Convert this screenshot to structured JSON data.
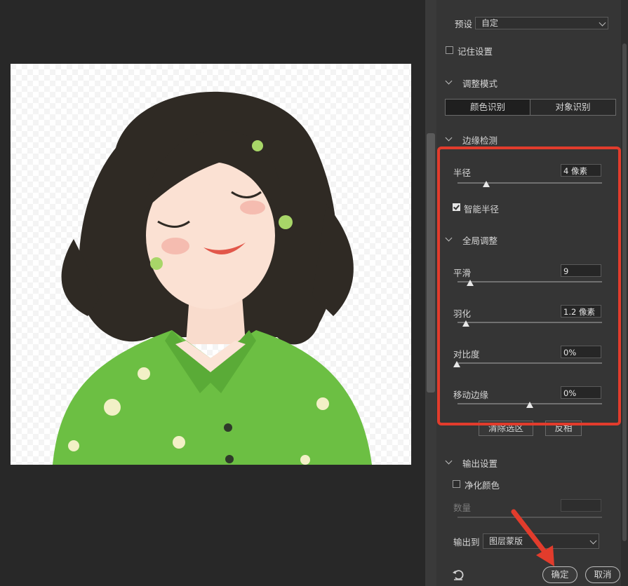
{
  "preset": {
    "label": "预设",
    "value": "自定"
  },
  "remember_settings": {
    "label": "记住设置",
    "checked": false
  },
  "adjust_mode": {
    "title": "调整模式",
    "options": [
      "颜色识别",
      "对象识别"
    ],
    "selected": "颜色识别"
  },
  "edge_detection": {
    "title": "边缘检测",
    "radius": {
      "label": "半径",
      "value": "4 像素",
      "level": 0.2
    },
    "smart_radius": {
      "label": "智能半径",
      "checked": true
    }
  },
  "global_refine": {
    "title": "全局调整",
    "smooth": {
      "label": "平滑",
      "value": "9",
      "level": 0.09
    },
    "feather": {
      "label": "羽化",
      "value": "1.2 像素",
      "level": 0.06
    },
    "contrast": {
      "label": "对比度",
      "value": "0%",
      "level": 0
    },
    "shift_edge": {
      "label": "移动边缘",
      "value": "0%",
      "level": 0.5
    }
  },
  "actions": {
    "clear_selection": "清除选区",
    "invert": "反相"
  },
  "output": {
    "title": "输出设置",
    "decontaminate": {
      "label": "净化颜色",
      "checked": false
    },
    "amount": {
      "label": "数量",
      "value": ""
    },
    "output_to": {
      "label": "输出到",
      "value": "图层蒙版"
    }
  },
  "buttons": {
    "ok": "确定",
    "cancel": "取消"
  },
  "colors": {
    "highlight_box": "#e23c2c",
    "arrow": "#e23c2c",
    "panel_bg": "#353535",
    "canvas_bg": "#282828"
  }
}
